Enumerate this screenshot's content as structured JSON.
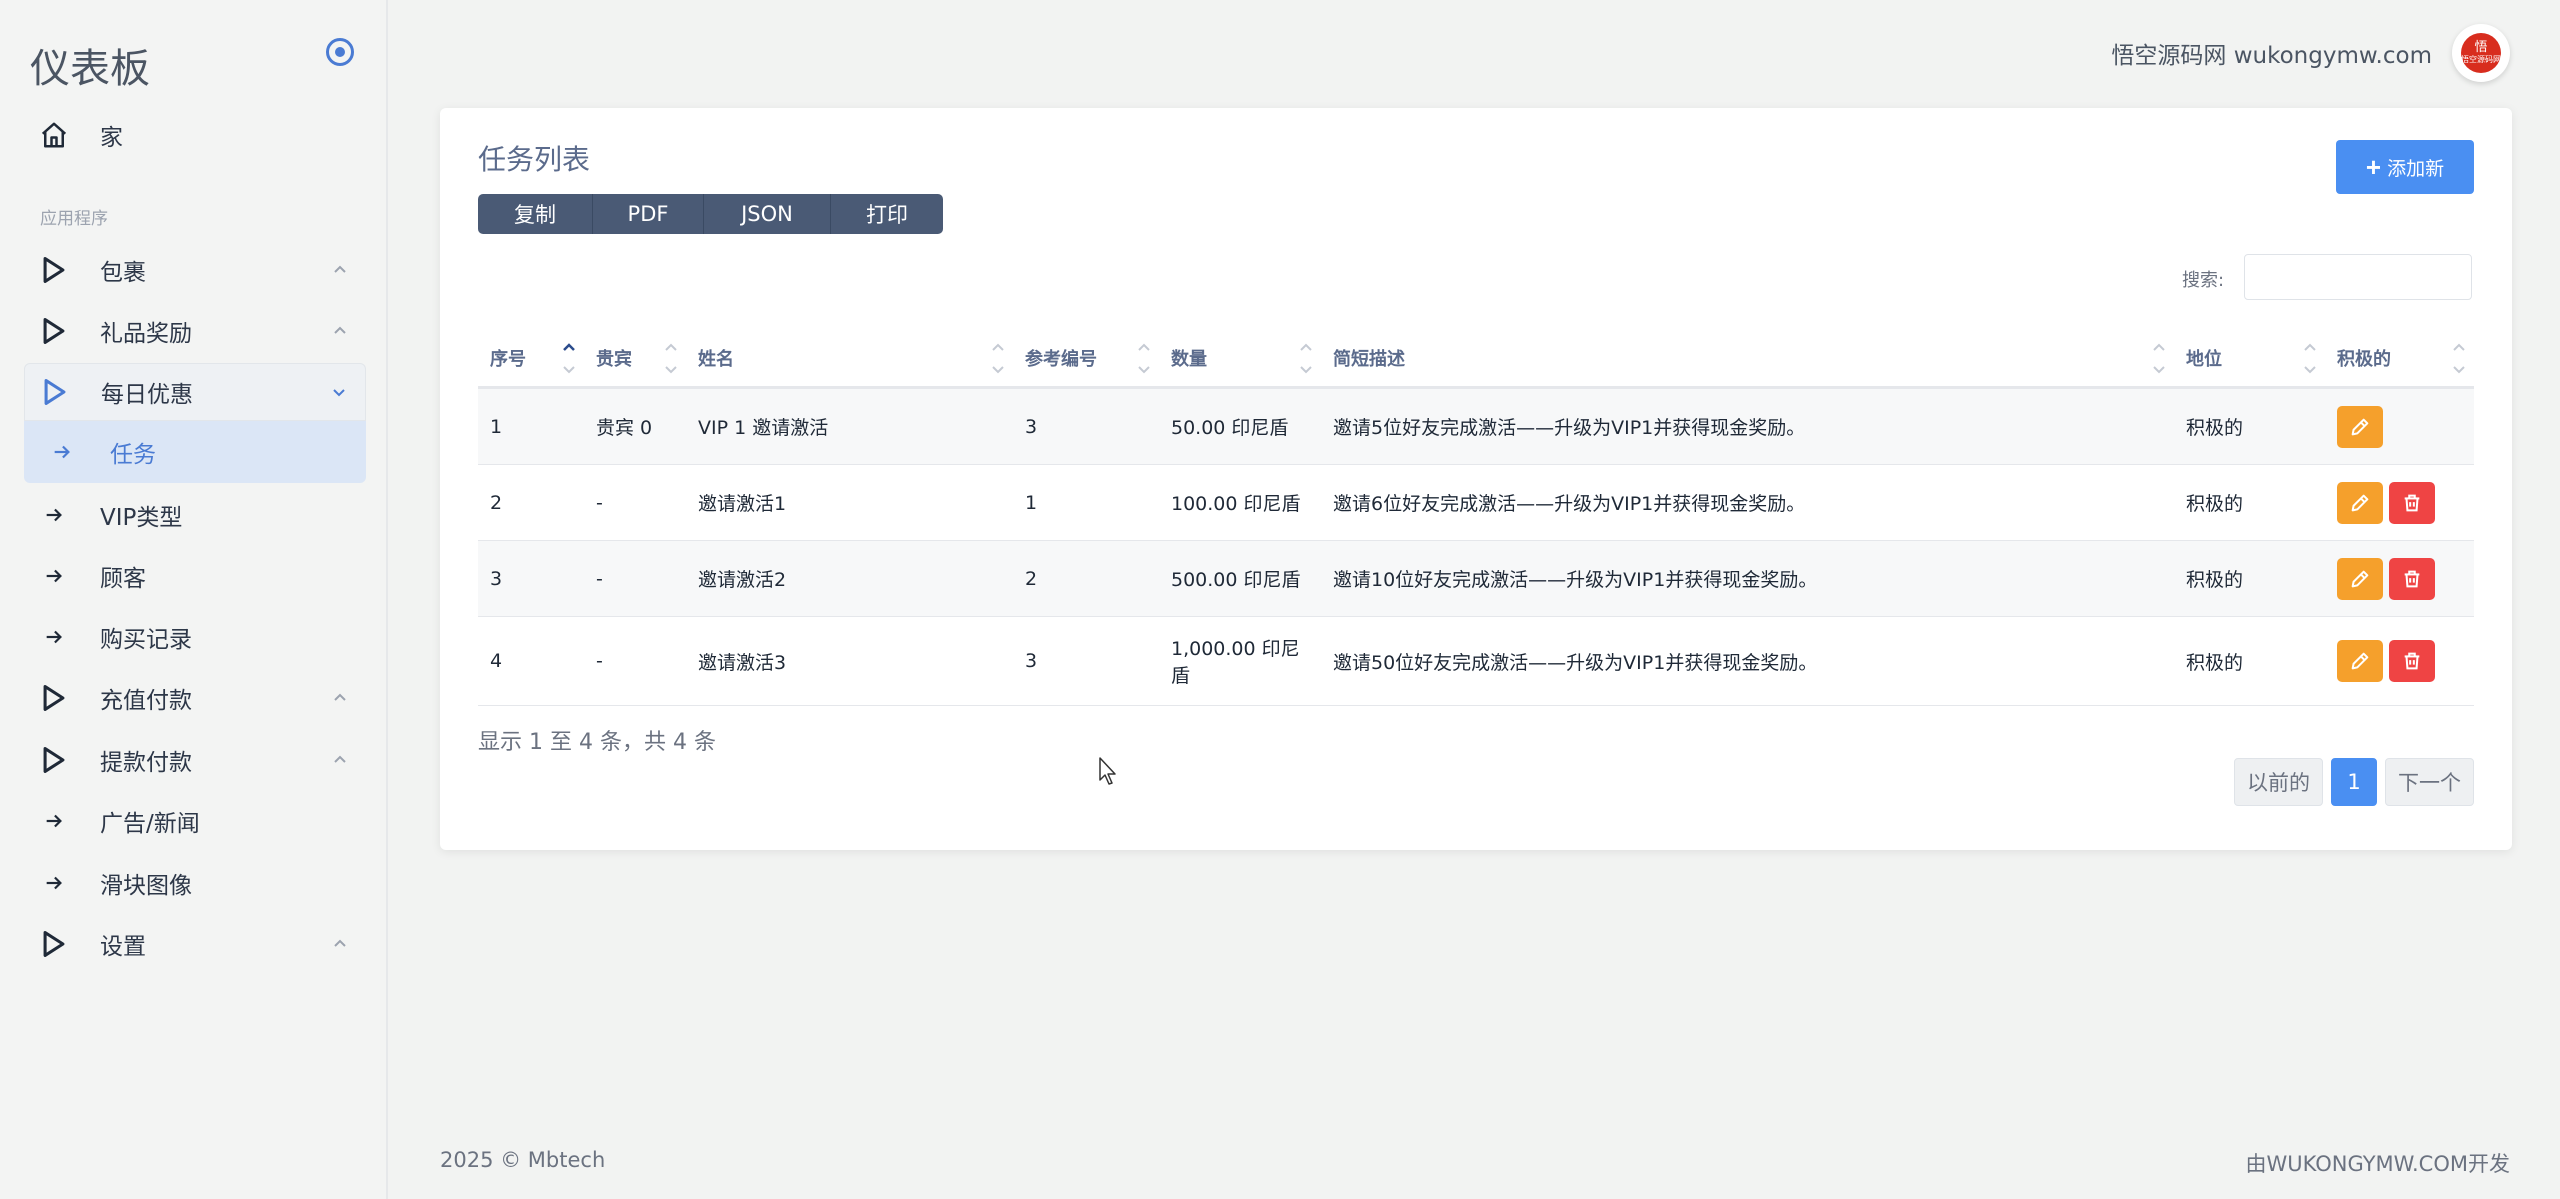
{
  "sidebar": {
    "brand": "仪表板",
    "home": "家",
    "section": "应用程序",
    "items": [
      {
        "label": "包裹"
      },
      {
        "label": "礼品奖励"
      },
      {
        "label": "每日优惠"
      },
      {
        "label": "任务"
      },
      {
        "label": "VIP类型"
      },
      {
        "label": "顾客"
      },
      {
        "label": "购买记录"
      },
      {
        "label": "充值付款"
      },
      {
        "label": "提款付款"
      },
      {
        "label": "广告/新闻"
      },
      {
        "label": "滑块图像"
      },
      {
        "label": "设置"
      }
    ]
  },
  "header": {
    "site": "悟空源码网 wukongymw.com",
    "avatar_text_top": "悟",
    "avatar_text_bottom": "悟空源码网"
  },
  "card": {
    "title": "任务列表",
    "add_label": "添加新",
    "export": [
      "复制",
      "PDF",
      "JSON",
      "打印"
    ],
    "search_label": "搜索:",
    "search_value": ""
  },
  "table": {
    "headers": [
      "序号",
      "贵宾",
      "姓名",
      "参考编号",
      "数量",
      "简短描述",
      "地位",
      "积极的"
    ],
    "rows": [
      {
        "no": "1",
        "vip": "贵宾 0",
        "name": "VIP 1 邀请激活",
        "ref": "3",
        "qty": "50.00 印尼盾",
        "desc": "邀请5位好友完成激活——升级为VIP1并获得现金奖励。",
        "status": "积极的"
      },
      {
        "no": "2",
        "vip": "-",
        "name": "邀请激活1",
        "ref": "1",
        "qty": "100.00 印尼盾",
        "desc": "邀请6位好友完成激活——升级为VIP1并获得现金奖励。",
        "status": "积极的"
      },
      {
        "no": "3",
        "vip": "-",
        "name": "邀请激活2",
        "ref": "2",
        "qty": "500.00 印尼盾",
        "desc": "邀请10位好友完成激活——升级为VIP1并获得现金奖励。",
        "status": "积极的"
      },
      {
        "no": "4",
        "vip": "-",
        "name": "邀请激活3",
        "ref": "3",
        "qty": "1,000.00 印尼盾",
        "desc": "邀请50位好友完成激活——升级为VIP1并获得现金奖励。",
        "status": "积极的"
      }
    ],
    "info": "显示 1 至 4 条，共 4 条"
  },
  "pagination": {
    "prev": "以前的",
    "current": "1",
    "next": "下一个"
  },
  "footer": {
    "left": "2025 © Mbtech",
    "right": "由WUKONGYMW.COM开发"
  },
  "colors": {
    "accent": "#4a8ff2",
    "edit": "#f5a02c",
    "delete": "#ef4444",
    "export_bg": "#4a5a75"
  }
}
